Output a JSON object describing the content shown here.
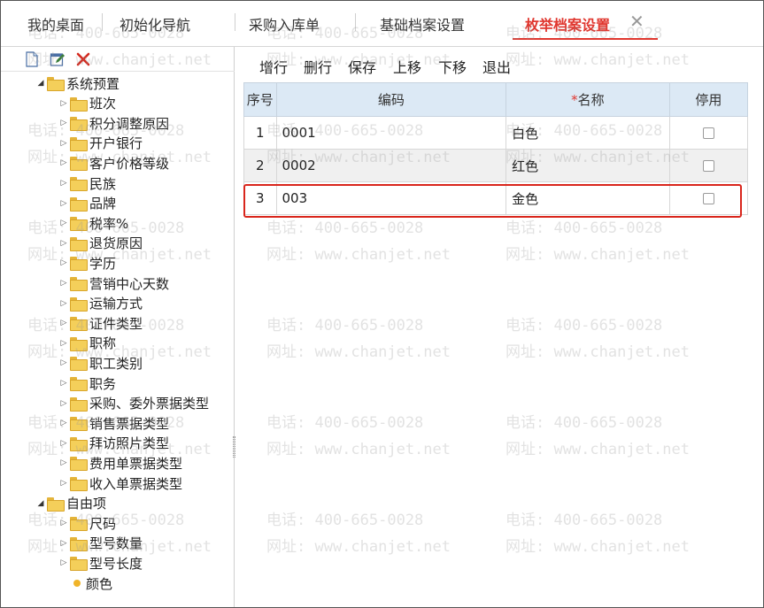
{
  "tabs": [
    {
      "label": "我的桌面"
    },
    {
      "label": "初始化导航"
    },
    {
      "label": "采购入库单"
    },
    {
      "label": "基础档案设置"
    },
    {
      "label": "枚举档案设置"
    }
  ],
  "tab_close_glyph": "✕",
  "left_toolbar": {
    "icons": [
      "new-icon",
      "edit-icon",
      "delete-icon"
    ]
  },
  "tree": {
    "groups": [
      {
        "label": "系统预置",
        "items": [
          "班次",
          "积分调整原因",
          "开户银行",
          "客户价格等级",
          "民族",
          "品牌",
          "税率%",
          "退货原因",
          "学历",
          "营销中心天数",
          "运输方式",
          "证件类型",
          "职称",
          "职工类别",
          "职务",
          "采购、委外票据类型",
          "销售票据类型",
          "拜访照片类型",
          "费用单票据类型",
          "收入单票据类型"
        ]
      },
      {
        "label": "自由项",
        "items": [
          "尺码",
          "型号数量",
          "型号长度"
        ],
        "selected_leaf": "颜色"
      }
    ]
  },
  "toolbar": {
    "buttons": [
      "增行",
      "删行",
      "保存",
      "上移",
      "下移",
      "退出"
    ]
  },
  "grid": {
    "headers": [
      "序号",
      "编码",
      "名称",
      "停用"
    ],
    "required_mark": "*",
    "rows": [
      {
        "no": "1",
        "code": "0001",
        "name": "白色",
        "disabled": false
      },
      {
        "no": "2",
        "code": "0002",
        "name": "红色",
        "disabled": false
      },
      {
        "no": "3",
        "code": "003",
        "name": "金色",
        "disabled": false
      }
    ]
  },
  "watermark": {
    "phone": "电话: 400-665-0028",
    "site": "网址: www.chanjet.net"
  }
}
